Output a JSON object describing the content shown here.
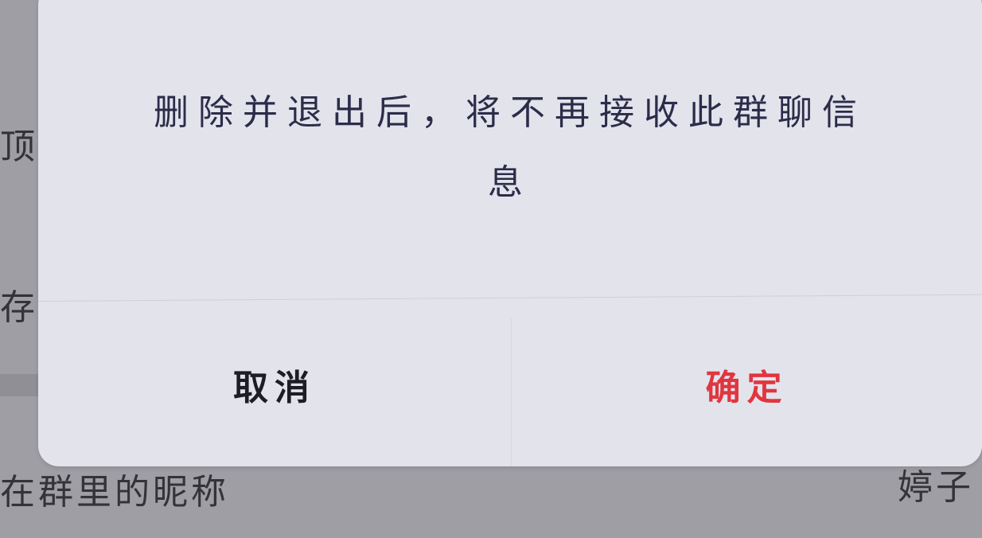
{
  "background": {
    "left_fragment_1": "顶",
    "left_fragment_2": "存",
    "group_nickname_label": "在群里的昵称",
    "group_nickname_value": "婷子"
  },
  "dialog": {
    "message_line_1": "删除并退出后，将不再接收此群聊信",
    "message_line_2": "息",
    "cancel_label": "取消",
    "confirm_label": "确定"
  },
  "colors": {
    "confirm": "#e0363f",
    "cancel": "#1d1d26",
    "message": "#2c2c4a",
    "dialog_bg": "#e3e3ec",
    "overlay_bg": "#9e9ea4"
  }
}
